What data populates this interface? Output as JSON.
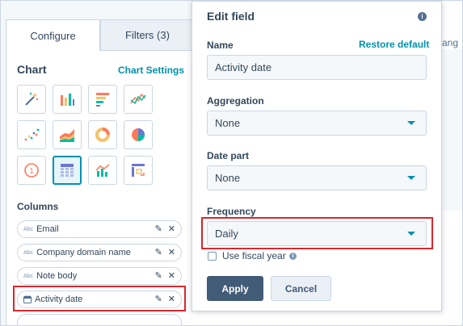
{
  "tabs": {
    "configure": "Configure",
    "filters": "Filters (3)"
  },
  "chart": {
    "heading": "Chart",
    "settings_link": "Chart Settings",
    "types": [
      {
        "name": "magic-wand-icon",
        "selected": false
      },
      {
        "name": "vertical-bar-chart-icon",
        "selected": false
      },
      {
        "name": "horizontal-bar-chart-icon",
        "selected": false
      },
      {
        "name": "line-chart-icon",
        "selected": false
      },
      {
        "name": "scatter-chart-icon",
        "selected": false
      },
      {
        "name": "area-chart-icon",
        "selected": false
      },
      {
        "name": "donut-chart-icon",
        "selected": false
      },
      {
        "name": "pie-chart-icon",
        "selected": false
      },
      {
        "name": "kpi-icon",
        "selected": false
      },
      {
        "name": "table-icon",
        "selected": true
      },
      {
        "name": "combo-chart-icon",
        "selected": false
      },
      {
        "name": "pivot-table-icon",
        "selected": false
      }
    ]
  },
  "columns": {
    "heading": "Columns",
    "items": [
      {
        "type": "Abc",
        "label": "Email"
      },
      {
        "type": "Abc",
        "label": "Company domain name"
      },
      {
        "type": "Abc",
        "label": "Note body"
      },
      {
        "type": "calendar",
        "label": "Activity date"
      }
    ]
  },
  "background": {
    "partial_text": "ang"
  },
  "panel": {
    "title": "Edit field",
    "name_label": "Name",
    "restore_link": "Restore default",
    "name_value": "Activity date",
    "aggregation_label": "Aggregation",
    "aggregation_value": "None",
    "date_part_label": "Date part",
    "date_part_value": "None",
    "frequency_label": "Frequency",
    "frequency_value": "Daily",
    "fiscal_label": "Use fiscal year",
    "apply": "Apply",
    "cancel": "Cancel"
  },
  "colors": {
    "accent": "#0091ae",
    "highlight": "#d9262c",
    "apply": "#425b76"
  }
}
